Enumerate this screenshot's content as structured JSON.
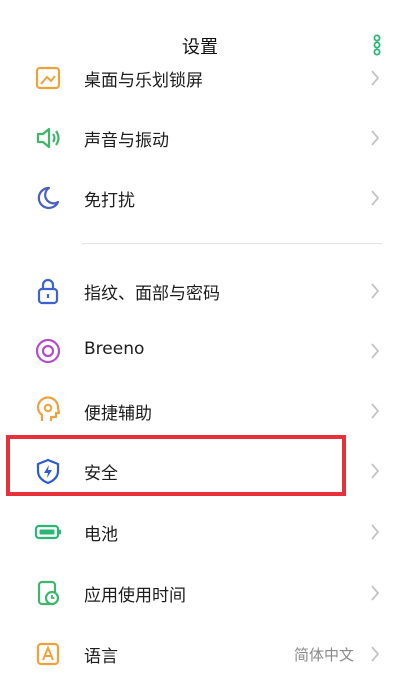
{
  "header": {
    "title": "设置"
  },
  "colors": {
    "accent": "#2bb673",
    "highlight": "#e8303a"
  },
  "items": [
    {
      "label": "桌面与乐划锁屏",
      "icon": "wallpaper-icon"
    },
    {
      "label": "声音与振动",
      "icon": "speaker-icon"
    },
    {
      "label": "免打扰",
      "icon": "moon-icon"
    },
    {
      "label": "指纹、面部与密码",
      "icon": "lock-icon"
    },
    {
      "label": "Breeno",
      "icon": "breeno-icon"
    },
    {
      "label": "便捷辅助",
      "icon": "assist-icon"
    },
    {
      "label": "安全",
      "icon": "shield-icon"
    },
    {
      "label": "电池",
      "icon": "battery-icon"
    },
    {
      "label": "应用使用时间",
      "icon": "app-time-icon"
    },
    {
      "label": "语言",
      "icon": "language-icon",
      "value": "简体中文"
    }
  ]
}
